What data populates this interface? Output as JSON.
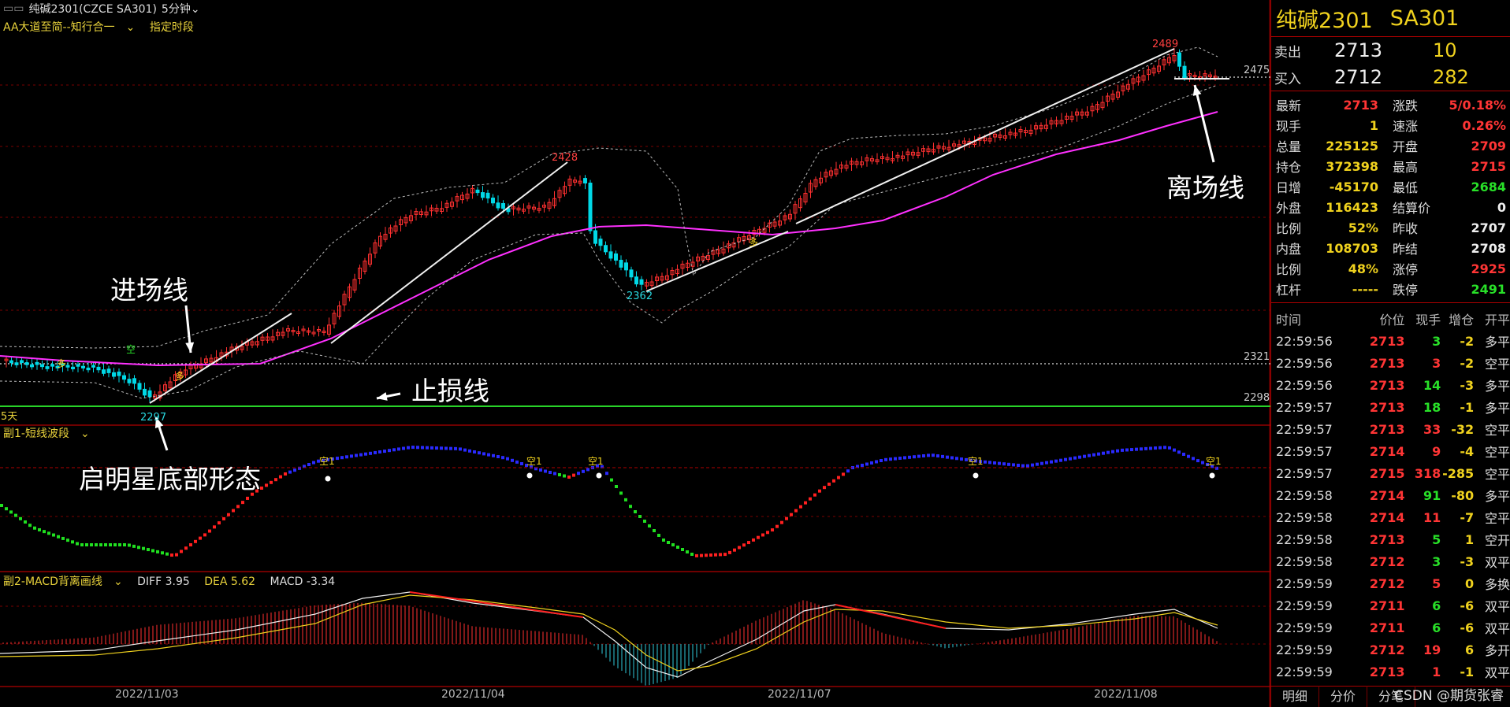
{
  "header": {
    "symbol_full": "纯碱2301(CZCE SA301)",
    "timeframe": "5分钟",
    "indicator_main": "AA大道至简--知行合一",
    "indicator_period": "指定时段"
  },
  "sub1": {
    "title": "副1-短线波段"
  },
  "sub2": {
    "title": "副2-MACD背离画线",
    "diff": "DIFF 3.95",
    "dea": "DEA 5.62",
    "macd": "MACD -3.34"
  },
  "annotations": {
    "entry": "进场线",
    "stop": "止损线",
    "exit": "离场线",
    "pattern": "启明星底部形态"
  },
  "labels": {
    "h2428": "2428",
    "h2489": "2489",
    "l2362": "2362",
    "l2297": "2297",
    "p2475": "2475",
    "p2321": "2321",
    "p2298": "2298",
    "days": "5天",
    "kong": "空",
    "duo": "多",
    "kong1": "空1"
  },
  "xaxis": [
    "2022/11/03",
    "2022/11/04",
    "2022/11/07",
    "2022/11/08"
  ],
  "colors": {
    "up": "#ff3030",
    "down": "#00d8e6",
    "ma": "#ff30ff",
    "stop": "#28d228"
  },
  "panel": {
    "name": "纯碱2301",
    "code": "SA301",
    "sell_label": "卖出",
    "sell_price": "2713",
    "sell_vol": "10",
    "buy_label": "买入",
    "buy_price": "2712",
    "buy_vol": "282",
    "stats": [
      {
        "k": "最新",
        "v": "2713",
        "vc": "#ff3535",
        "k2": "涨跌",
        "v2": "5/0.18%",
        "v2c": "#ff3535"
      },
      {
        "k": "现手",
        "v": "1",
        "vc": "#f0d21e",
        "k2": "速涨",
        "v2": "0.26%",
        "v2c": "#ff3535"
      },
      {
        "k": "总量",
        "v": "225125",
        "vc": "#f0d21e",
        "k2": "开盘",
        "v2": "2709",
        "v2c": "#ff3535"
      },
      {
        "k": "持仓",
        "v": "372398",
        "vc": "#f0d21e",
        "k2": "最高",
        "v2": "2715",
        "v2c": "#ff3535"
      },
      {
        "k": "日增",
        "v": "-45170",
        "vc": "#f0d21e",
        "k2": "最低",
        "v2": "2684",
        "v2c": "#28e028"
      },
      {
        "k": "外盘",
        "v": "116423",
        "vc": "#f0d21e",
        "k2": "结算价",
        "v2": "0",
        "v2c": "#eee"
      },
      {
        "k": "比例",
        "v": "52%",
        "vc": "#f0d21e",
        "k2": "昨收",
        "v2": "2707",
        "v2c": "#eee"
      },
      {
        "k": "内盘",
        "v": "108703",
        "vc": "#f0d21e",
        "k2": "昨结",
        "v2": "2708",
        "v2c": "#eee"
      },
      {
        "k": "比例",
        "v": "48%",
        "vc": "#f0d21e",
        "k2": "涨停",
        "v2": "2925",
        "v2c": "#ff3535"
      },
      {
        "k": "杠杆",
        "v": "-----",
        "vc": "#f0d21e",
        "k2": "跌停",
        "v2": "2491",
        "v2c": "#28e028"
      }
    ],
    "trade_headers": [
      "时间",
      "价位",
      "现手",
      "增仓",
      "开平"
    ],
    "trades": [
      {
        "t": "22:59:56",
        "p": "2713",
        "v": "3",
        "vc": "#28e028",
        "c": "-2",
        "o": "多平"
      },
      {
        "t": "22:59:56",
        "p": "2713",
        "v": "3",
        "vc": "#ff3535",
        "c": "-2",
        "o": "空平"
      },
      {
        "t": "22:59:56",
        "p": "2713",
        "v": "14",
        "vc": "#28e028",
        "c": "-3",
        "o": "多平"
      },
      {
        "t": "22:59:57",
        "p": "2713",
        "v": "18",
        "vc": "#28e028",
        "c": "-1",
        "o": "多平"
      },
      {
        "t": "22:59:57",
        "p": "2713",
        "v": "33",
        "vc": "#ff3535",
        "c": "-32",
        "o": "空平"
      },
      {
        "t": "22:59:57",
        "p": "2714",
        "v": "9",
        "vc": "#ff3535",
        "c": "-4",
        "o": "空平"
      },
      {
        "t": "22:59:57",
        "p": "2715",
        "v": "318",
        "vc": "#ff3535",
        "c": "-285",
        "o": "空平"
      },
      {
        "t": "22:59:58",
        "p": "2714",
        "v": "91",
        "vc": "#28e028",
        "c": "-80",
        "o": "多平"
      },
      {
        "t": "22:59:58",
        "p": "2714",
        "v": "11",
        "vc": "#ff3535",
        "c": "-7",
        "o": "空平"
      },
      {
        "t": "22:59:58",
        "p": "2713",
        "v": "5",
        "vc": "#28e028",
        "c": "1",
        "o": "空开"
      },
      {
        "t": "22:59:58",
        "p": "2712",
        "v": "3",
        "vc": "#28e028",
        "c": "-3",
        "o": "双平"
      },
      {
        "t": "22:59:59",
        "p": "2712",
        "v": "5",
        "vc": "#ff3535",
        "c": "0",
        "o": "多换"
      },
      {
        "t": "22:59:59",
        "p": "2711",
        "v": "6",
        "vc": "#28e028",
        "c": "-6",
        "o": "双平"
      },
      {
        "t": "22:59:59",
        "p": "2711",
        "v": "6",
        "vc": "#28e028",
        "c": "-6",
        "o": "双平"
      },
      {
        "t": "22:59:59",
        "p": "2712",
        "v": "19",
        "vc": "#ff3535",
        "c": "6",
        "o": "多开"
      },
      {
        "t": "22:59:59",
        "p": "2713",
        "v": "1",
        "vc": "#ff3535",
        "c": "-1",
        "o": "双平"
      }
    ],
    "tabs": [
      "明细",
      "分价",
      "分笔"
    ],
    "watermark": "CSDN @期货张睿"
  }
}
